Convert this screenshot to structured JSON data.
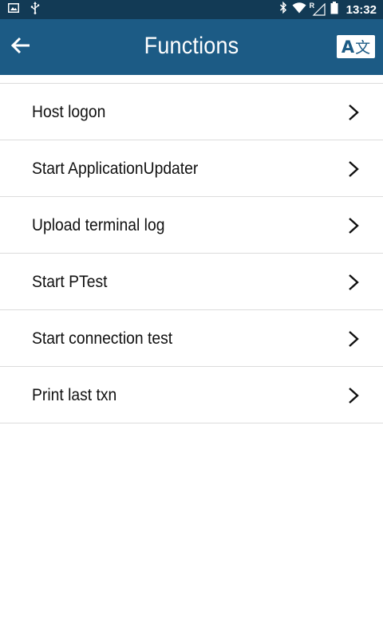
{
  "status_bar": {
    "time": "13:32",
    "network_label": "R",
    "icons": [
      "image-icon",
      "usb-icon",
      "bluetooth-icon",
      "wifi-icon",
      "signal-icon",
      "battery-icon"
    ]
  },
  "app_bar": {
    "title": "Functions",
    "back_icon": "arrow-left-icon",
    "language_button": {
      "latin": "A",
      "cjk": "文"
    }
  },
  "menu": {
    "items": [
      {
        "label": "Host logon"
      },
      {
        "label": "Start ApplicationUpdater"
      },
      {
        "label": "Upload terminal log"
      },
      {
        "label": "Start PTest"
      },
      {
        "label": "Start connection test"
      },
      {
        "label": "Print last txn"
      }
    ]
  },
  "colors": {
    "status_bar": "#123a55",
    "app_bar": "#1c5b85",
    "divider": "#dcdcdc",
    "text": "#111111"
  }
}
